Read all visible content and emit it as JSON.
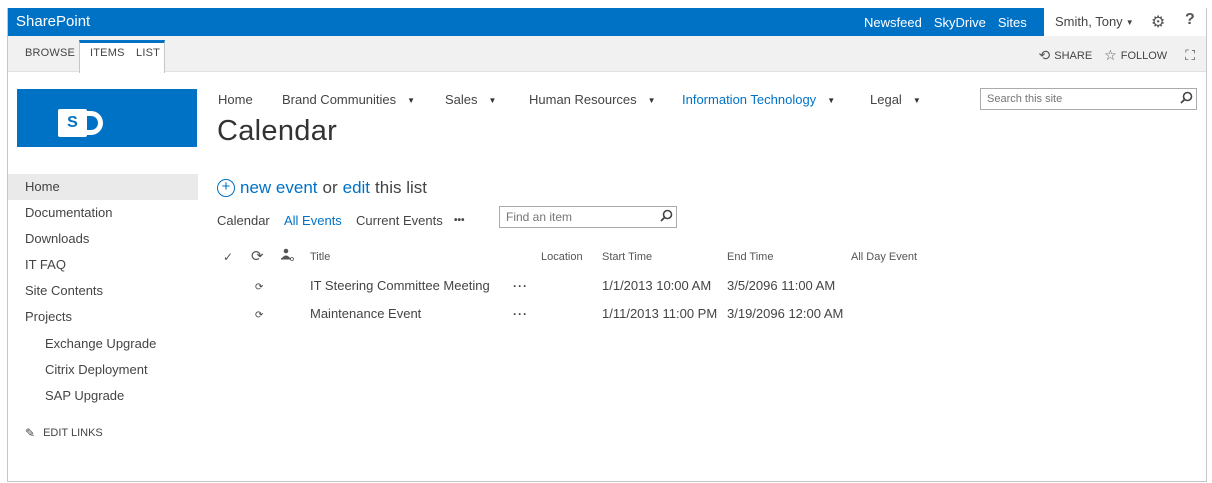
{
  "suite": {
    "brand": "SharePoint",
    "links": [
      "Newsfeed",
      "SkyDrive",
      "Sites"
    ],
    "user": "Smith, Tony",
    "help": "?"
  },
  "ribbon": {
    "tabs": [
      "BROWSE",
      "ITEMS",
      "LIST"
    ],
    "share": "SHARE",
    "follow": "FOLLOW"
  },
  "logo": {
    "letter": "S"
  },
  "topnav": {
    "home": "Home",
    "brand": "Brand Communities",
    "sales": "Sales",
    "hr": "Human Resources",
    "it": "Information Technology",
    "legal": "Legal"
  },
  "search": {
    "placeholder": "Search this site"
  },
  "page": {
    "title": "Calendar"
  },
  "leftnav": {
    "home": "Home",
    "documentation": "Documentation",
    "downloads": "Downloads",
    "itfaq": "IT FAQ",
    "sitecontents": "Site Contents",
    "projects": "Projects",
    "exchange": "Exchange Upgrade",
    "citrix": "Citrix Deployment",
    "sap": "SAP Upgrade",
    "editlinks": "EDIT LINKS"
  },
  "actions": {
    "new_event": "new event",
    "or": "or",
    "edit": "edit",
    "this_list": "this list"
  },
  "views": {
    "calendar": "Calendar",
    "all_events": "All Events",
    "current_events": "Current Events",
    "more": "•••",
    "find_placeholder": "Find an item"
  },
  "columns": {
    "title": "Title",
    "location": "Location",
    "start": "Start Time",
    "end": "End Time",
    "allday": "All Day Event"
  },
  "rows": [
    {
      "title": "IT Steering Committee Meeting",
      "location": "",
      "start": "1/1/2013 10:00 AM",
      "end": "3/5/2096 11:00 AM",
      "allday": ""
    },
    {
      "title": "Maintenance Event",
      "location": "",
      "start": "1/11/2013 11:00 PM",
      "end": "3/19/2096 12:00 AM",
      "allday": ""
    }
  ],
  "colors": {
    "accent": "#0072c6",
    "nav_selected": "#eaeaea"
  },
  "icons": [
    "gear-icon",
    "help-icon",
    "share-icon",
    "follow-icon",
    "focus-icon",
    "search-icon",
    "plus-icon",
    "pencil-icon",
    "recurrence-icon"
  ]
}
